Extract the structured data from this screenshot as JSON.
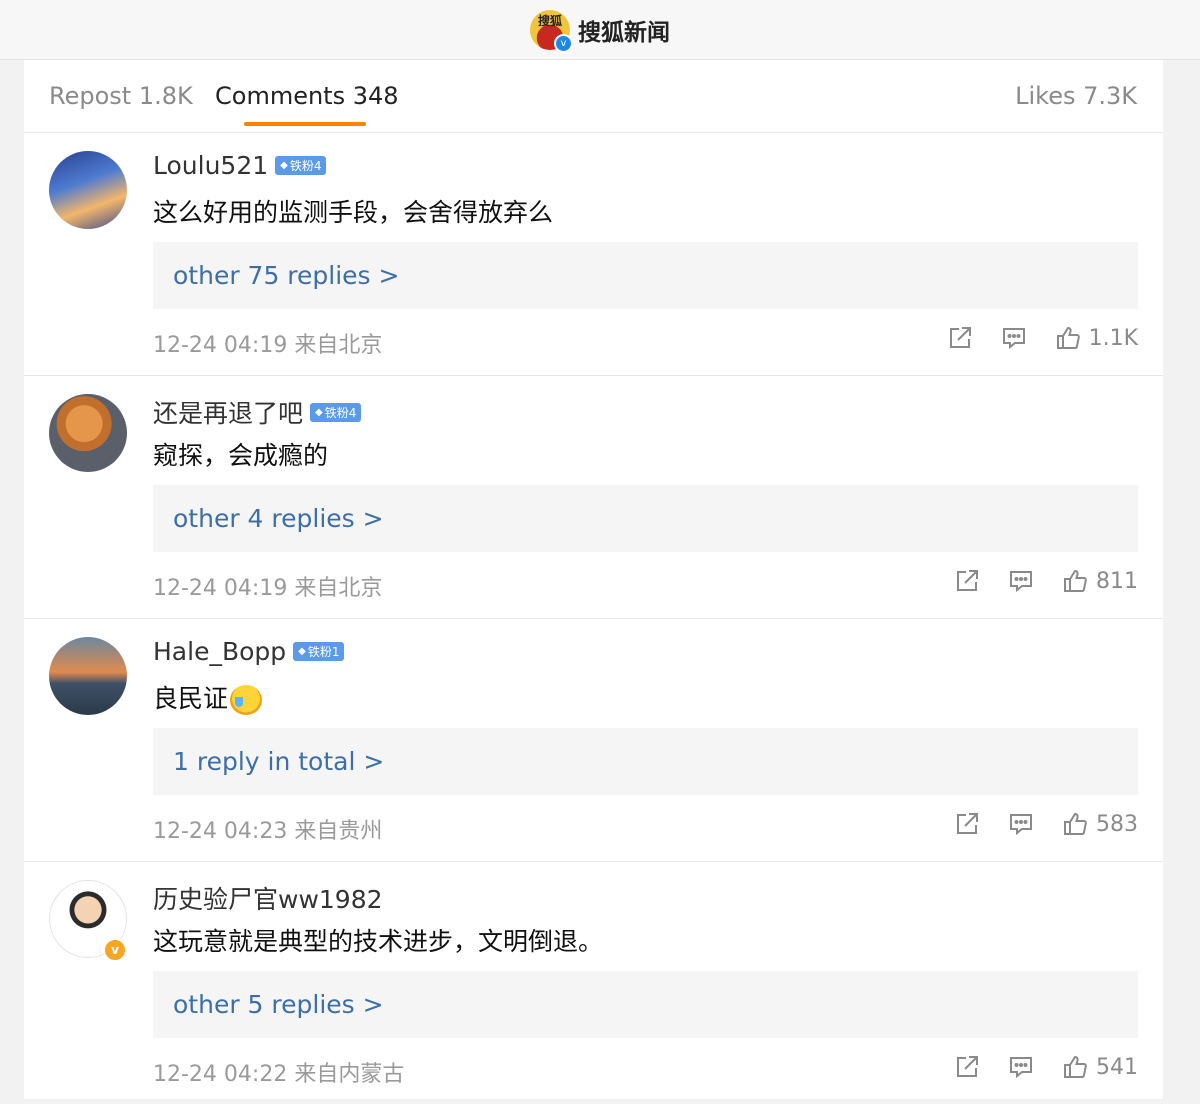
{
  "header": {
    "logo_text": "搜狐",
    "brand": "搜狐新闻"
  },
  "tabs": [
    {
      "label": "Repost 1.8K"
    },
    {
      "label": "Comments 348"
    },
    {
      "label": "Likes 7.3K"
    }
  ],
  "comments": [
    {
      "username": "Loulu521",
      "fan_badge": "铁粉4",
      "text": "这么好用的监测手段，会舍得放弃么",
      "replies": "other 75 replies >",
      "meta": "12-24 04:19 来自北京",
      "likes": "1.1K"
    },
    {
      "username": "还是再退了吧",
      "fan_badge": "铁粉4",
      "text": "窥探，会成瘾的",
      "replies": "other 4 replies >",
      "meta": "12-24 04:19 来自北京",
      "likes": "811"
    },
    {
      "username": "Hale_Bopp",
      "fan_badge": "铁粉1",
      "text": "良民证",
      "replies": "1 reply in total >",
      "meta": "12-24 04:23 来自贵州",
      "likes": "583"
    },
    {
      "username": "历史验尸官ww1982",
      "text": "这玩意就是典型的技术进步，文明倒退。",
      "replies": "other 5 replies >",
      "meta": "12-24 04:22 来自内蒙古",
      "likes": "541"
    }
  ],
  "colors": {
    "accent": "#ff8200",
    "link": "#3d6fa6",
    "fan_badge": "#5b9ae8"
  }
}
